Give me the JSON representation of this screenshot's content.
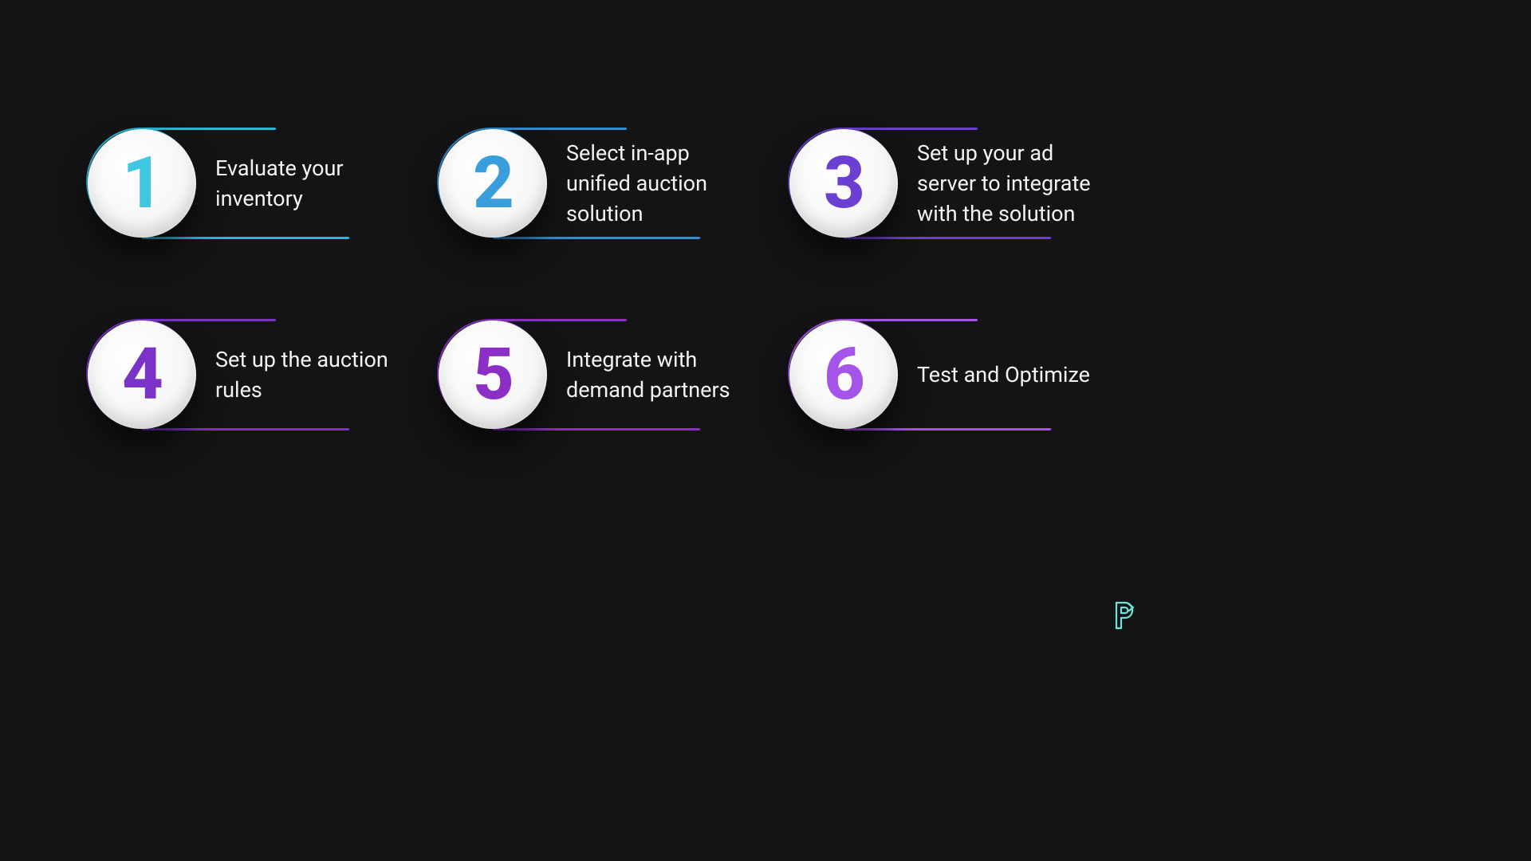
{
  "steps": [
    {
      "n": "1",
      "text": "Evaluate your inventory",
      "numColor": "#3fc6e0",
      "stroke": "#27b8d6",
      "topW": 168,
      "botW": 260
    },
    {
      "n": "2",
      "text": "Select in-app unified auction solution",
      "numColor": "#3a9edc",
      "stroke": "#2f8fd0",
      "topW": 168,
      "botW": 260
    },
    {
      "n": "3",
      "text": "Set up your ad server to integrate with the solution",
      "numColor": "#6a3fd1",
      "stroke": "#6a3fd1",
      "topW": 168,
      "botW": 260
    },
    {
      "n": "4",
      "text": "Set up the auction rules",
      "numColor": "#7a32c9",
      "stroke": "#7a32c9",
      "topW": 168,
      "botW": 260
    },
    {
      "n": "5",
      "text": "Integrate with demand partners",
      "numColor": "#8b2fc7",
      "stroke": "#8b2fc7",
      "topW": 168,
      "botW": 260
    },
    {
      "n": "6",
      "text": "Test and Optimize",
      "numColor": "#a454e8",
      "stroke": "#a454e8",
      "topW": 168,
      "botW": 260
    }
  ],
  "logo": {
    "name": "p-mark"
  }
}
